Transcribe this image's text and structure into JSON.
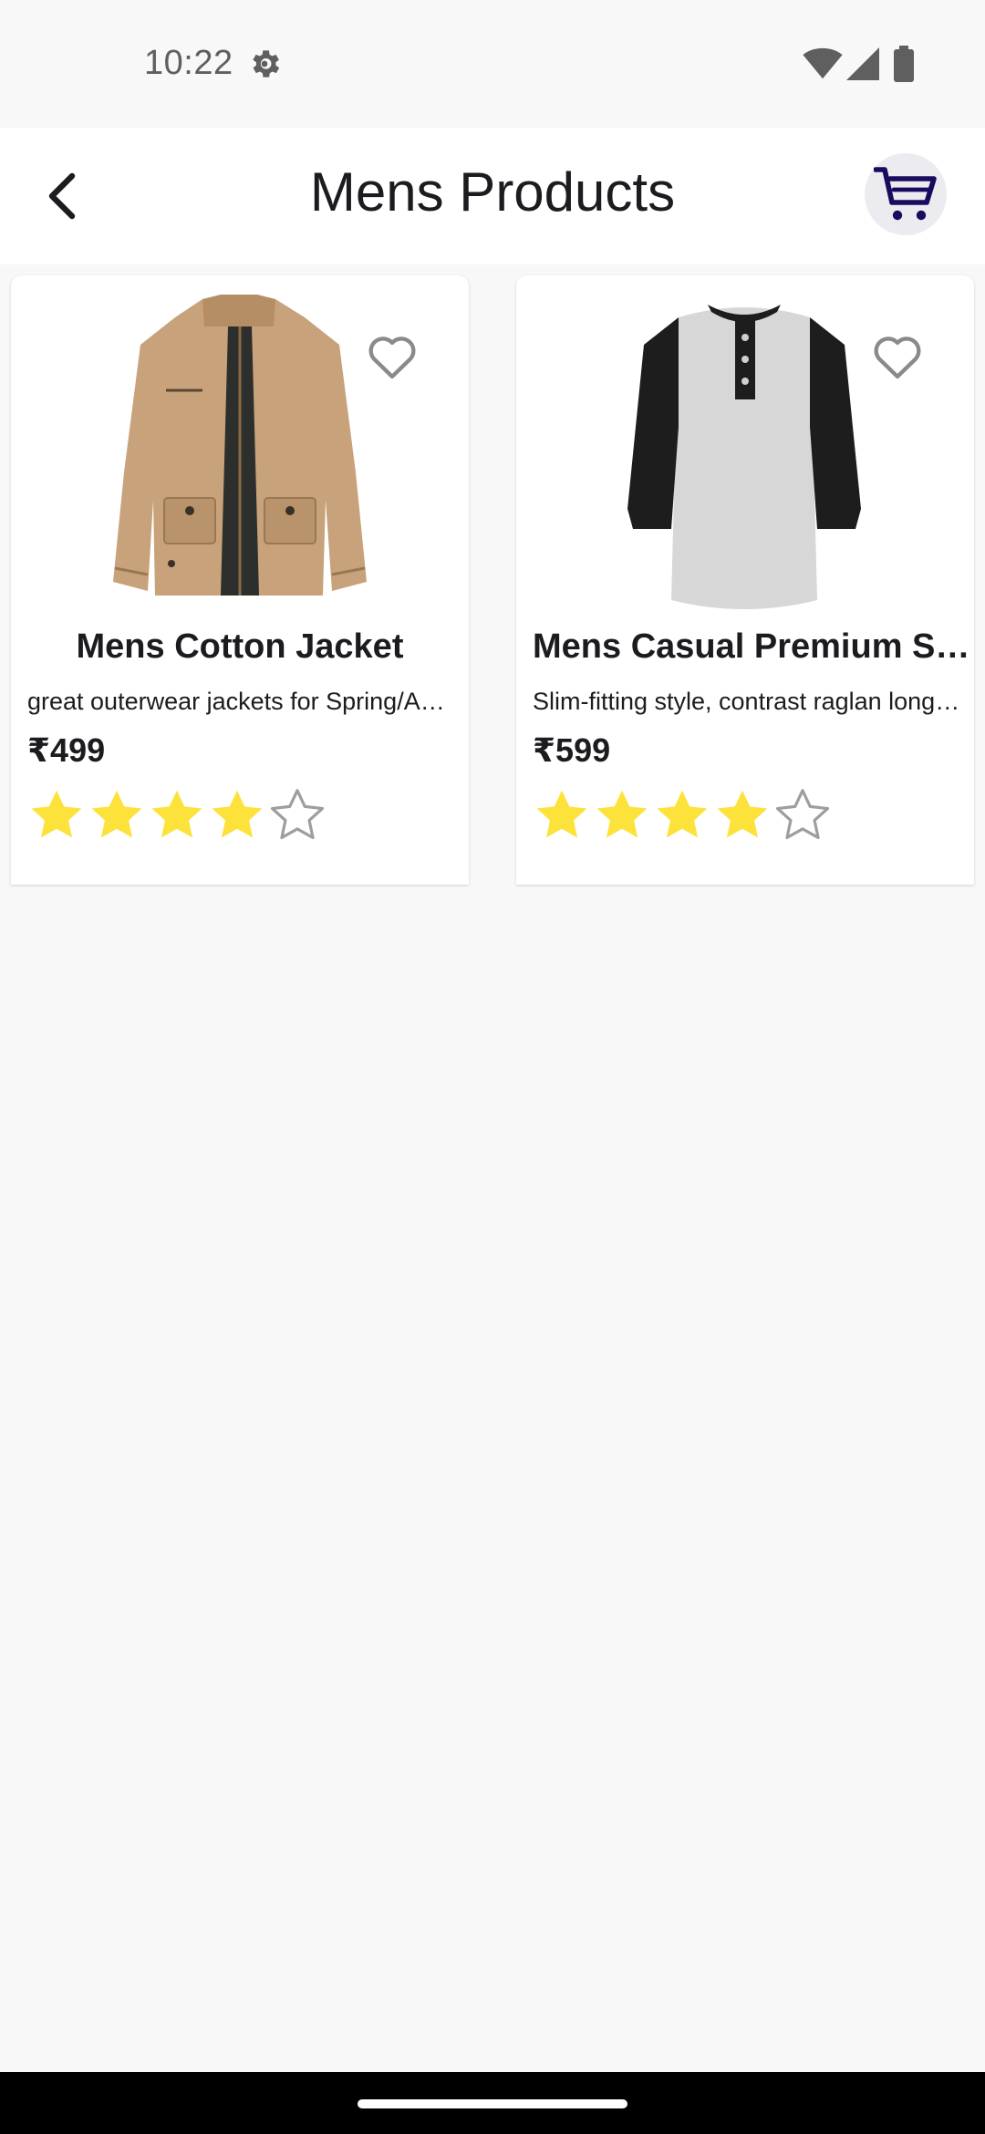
{
  "status_bar": {
    "time": "10:22",
    "icons": [
      "gear-icon",
      "wifi-icon",
      "signal-icon",
      "battery-icon"
    ]
  },
  "app_bar": {
    "title": "Mens Products",
    "back_icon": "chevron-left-icon",
    "cart_icon": "cart-icon",
    "accent_color": "#1a0b5e"
  },
  "products": [
    {
      "title": "Mens Cotton Jacket",
      "description": "great outerwear jackets for Spring/Autumn/Winter, suitable for many occasions, such as working, hiking, camping, mountain/rock climbing, cycling, traveling or other outdoors.",
      "price": "₹499",
      "rating_stars": 4,
      "rating_max": 5,
      "image": "beige-cotton-jacket",
      "favorite_icon": "heart-outline-icon"
    },
    {
      "title": "Mens Casual Premium Slim Fit T-Shirts",
      "description": "Slim-fitting style, contrast raglan long sleeve, three-button henley placket, light weight & soft fabric for breathable and comfortable wearing.",
      "price": "₹599",
      "rating_stars": 4,
      "rating_max": 5,
      "image": "grey-black-raglan-henley-shirt",
      "favorite_icon": "heart-outline-icon"
    }
  ],
  "colors": {
    "star_filled": "#fde23c",
    "star_empty": "#9e9e9e",
    "background": "#f8f8f8"
  }
}
